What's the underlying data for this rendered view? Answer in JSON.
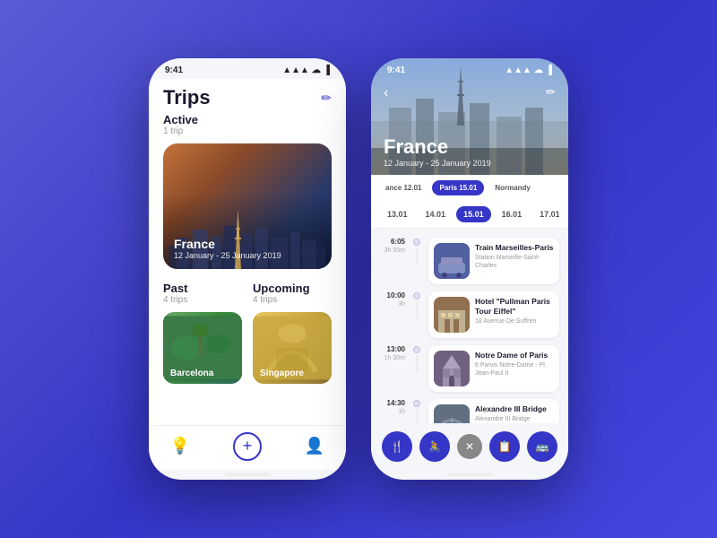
{
  "phone1": {
    "statusBar": {
      "time": "9:41",
      "signal": "●●●",
      "wifi": "▲",
      "battery": "▌"
    },
    "header": {
      "title": "Trips",
      "editIcon": "✏"
    },
    "active": {
      "label": "Active",
      "count": "1 trip",
      "trip": {
        "name": "France",
        "dates": "12 January - 25 January 2019"
      }
    },
    "past": {
      "label": "Past",
      "count": "4 trips",
      "items": [
        {
          "name": "Barcelona"
        }
      ]
    },
    "upcoming": {
      "label": "Upcoming",
      "count": "4 trips",
      "items": [
        {
          "name": "Singapore"
        }
      ]
    },
    "nav": {
      "items": [
        "💡",
        "+",
        "👤"
      ]
    }
  },
  "phone2": {
    "statusBar": {
      "time": "9:41"
    },
    "hero": {
      "country": "France",
      "dateRange": "12 January - 25 January 2019"
    },
    "segTabs": [
      {
        "label": "ance 12.01",
        "active": false
      },
      {
        "label": "Paris 15.01",
        "active": true
      },
      {
        "label": "Normandy",
        "active": false
      }
    ],
    "dayTabs": [
      {
        "label": "13.01",
        "active": false
      },
      {
        "label": "14.01",
        "active": false
      },
      {
        "label": "15.01",
        "active": true
      },
      {
        "label": "16.01",
        "active": false
      },
      {
        "label": "17.01",
        "active": false
      }
    ],
    "itinerary": [
      {
        "time": "6:05",
        "duration": "3h 55m",
        "name": "Train Marseilles-Paris",
        "sub": "Station Marseille-Saint-Charles",
        "thumb": "train"
      },
      {
        "time": "10:00",
        "duration": "3h",
        "name": "Hotel \"Pullman Paris Tour Eiffel\"",
        "sub": "18 Avenue De Suffren",
        "thumb": "hotel"
      },
      {
        "time": "13:00",
        "duration": "1h 30m",
        "name": "Notre Dame of Paris",
        "sub": "6 Parvis Notre-Dame - Pl. Jean-Paul II",
        "thumb": "notredame"
      },
      {
        "time": "14:30",
        "duration": "1h",
        "name": "Alexandre III Bridge",
        "sub": "Alexandre III Bridge",
        "thumb": "bridge"
      }
    ],
    "actionBar": {
      "icons": [
        "🍴",
        "🚴",
        "📋",
        "🚌"
      ],
      "closeIcon": "✕"
    }
  }
}
